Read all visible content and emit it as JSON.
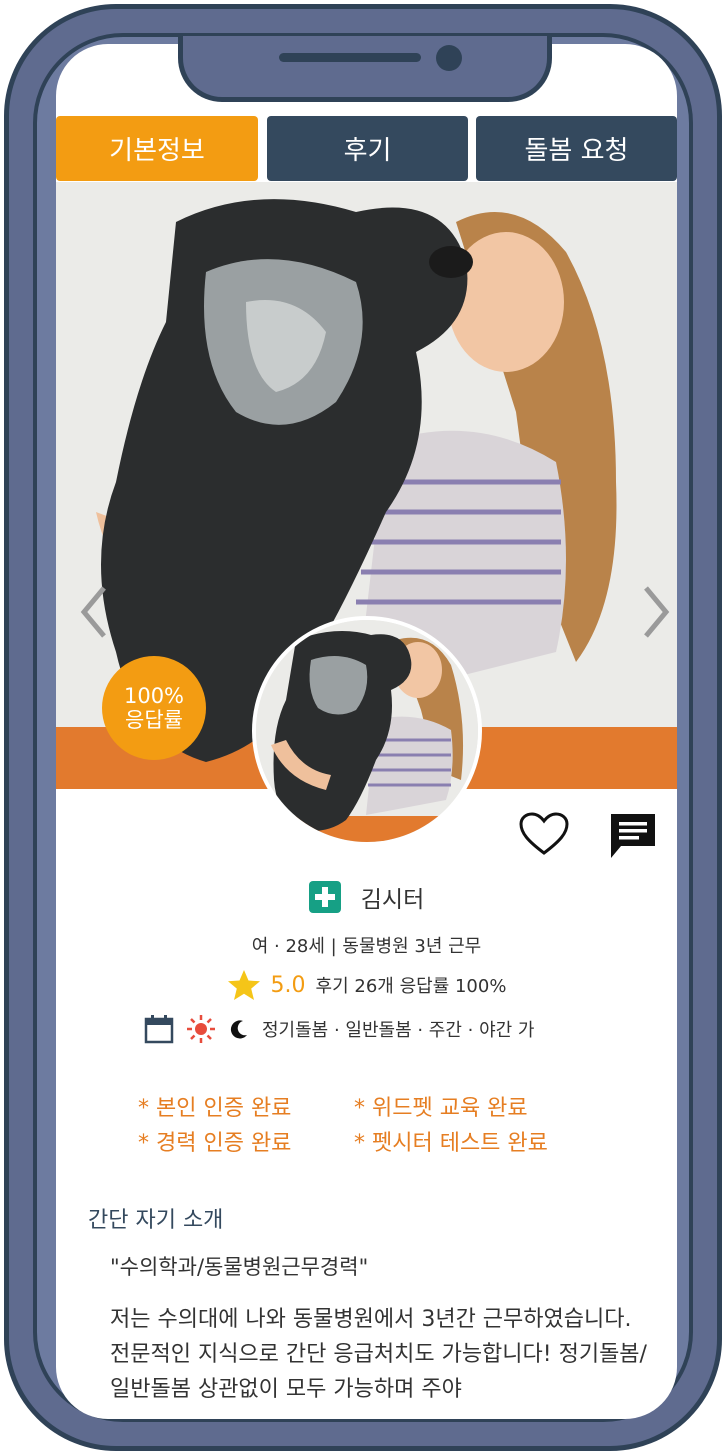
{
  "tabs": {
    "basic_info": "기본정보",
    "reviews": "후기",
    "care_request": "돌봄 요청"
  },
  "badge": {
    "line1": "100%",
    "line2": "응답률"
  },
  "profile": {
    "name": "김시터",
    "details": "여 · 28세 |  동물병원 3년 근무",
    "rating": "5.0",
    "rating_details": "후기 26개 응답률 100%",
    "schedule": "정기돌봄 · 일반돌봄 · 주간 · 야간 가"
  },
  "certifications": {
    "identity": "* 본인 인증 완료",
    "education": "* 위드펫 교육 완료",
    "career": "* 경력 인증 완료",
    "test": "* 펫시터 테스트 완료"
  },
  "intro": {
    "title": "간단 자기 소개",
    "quote": "\"수의학과/동물병원근무경력\"",
    "body": "저는 수의대에 나와 동물병원에서 3년간 근무하였습니다. 전문적인 지식으로 간단 응급처치도 가능합니다! 정기돌봄/일반돌봄 상관없이 모두 가능하며 주야"
  },
  "colors": {
    "accent": "#f39c12",
    "navy": "#34495e",
    "cert": "#e67e22",
    "medical": "#16a085"
  }
}
